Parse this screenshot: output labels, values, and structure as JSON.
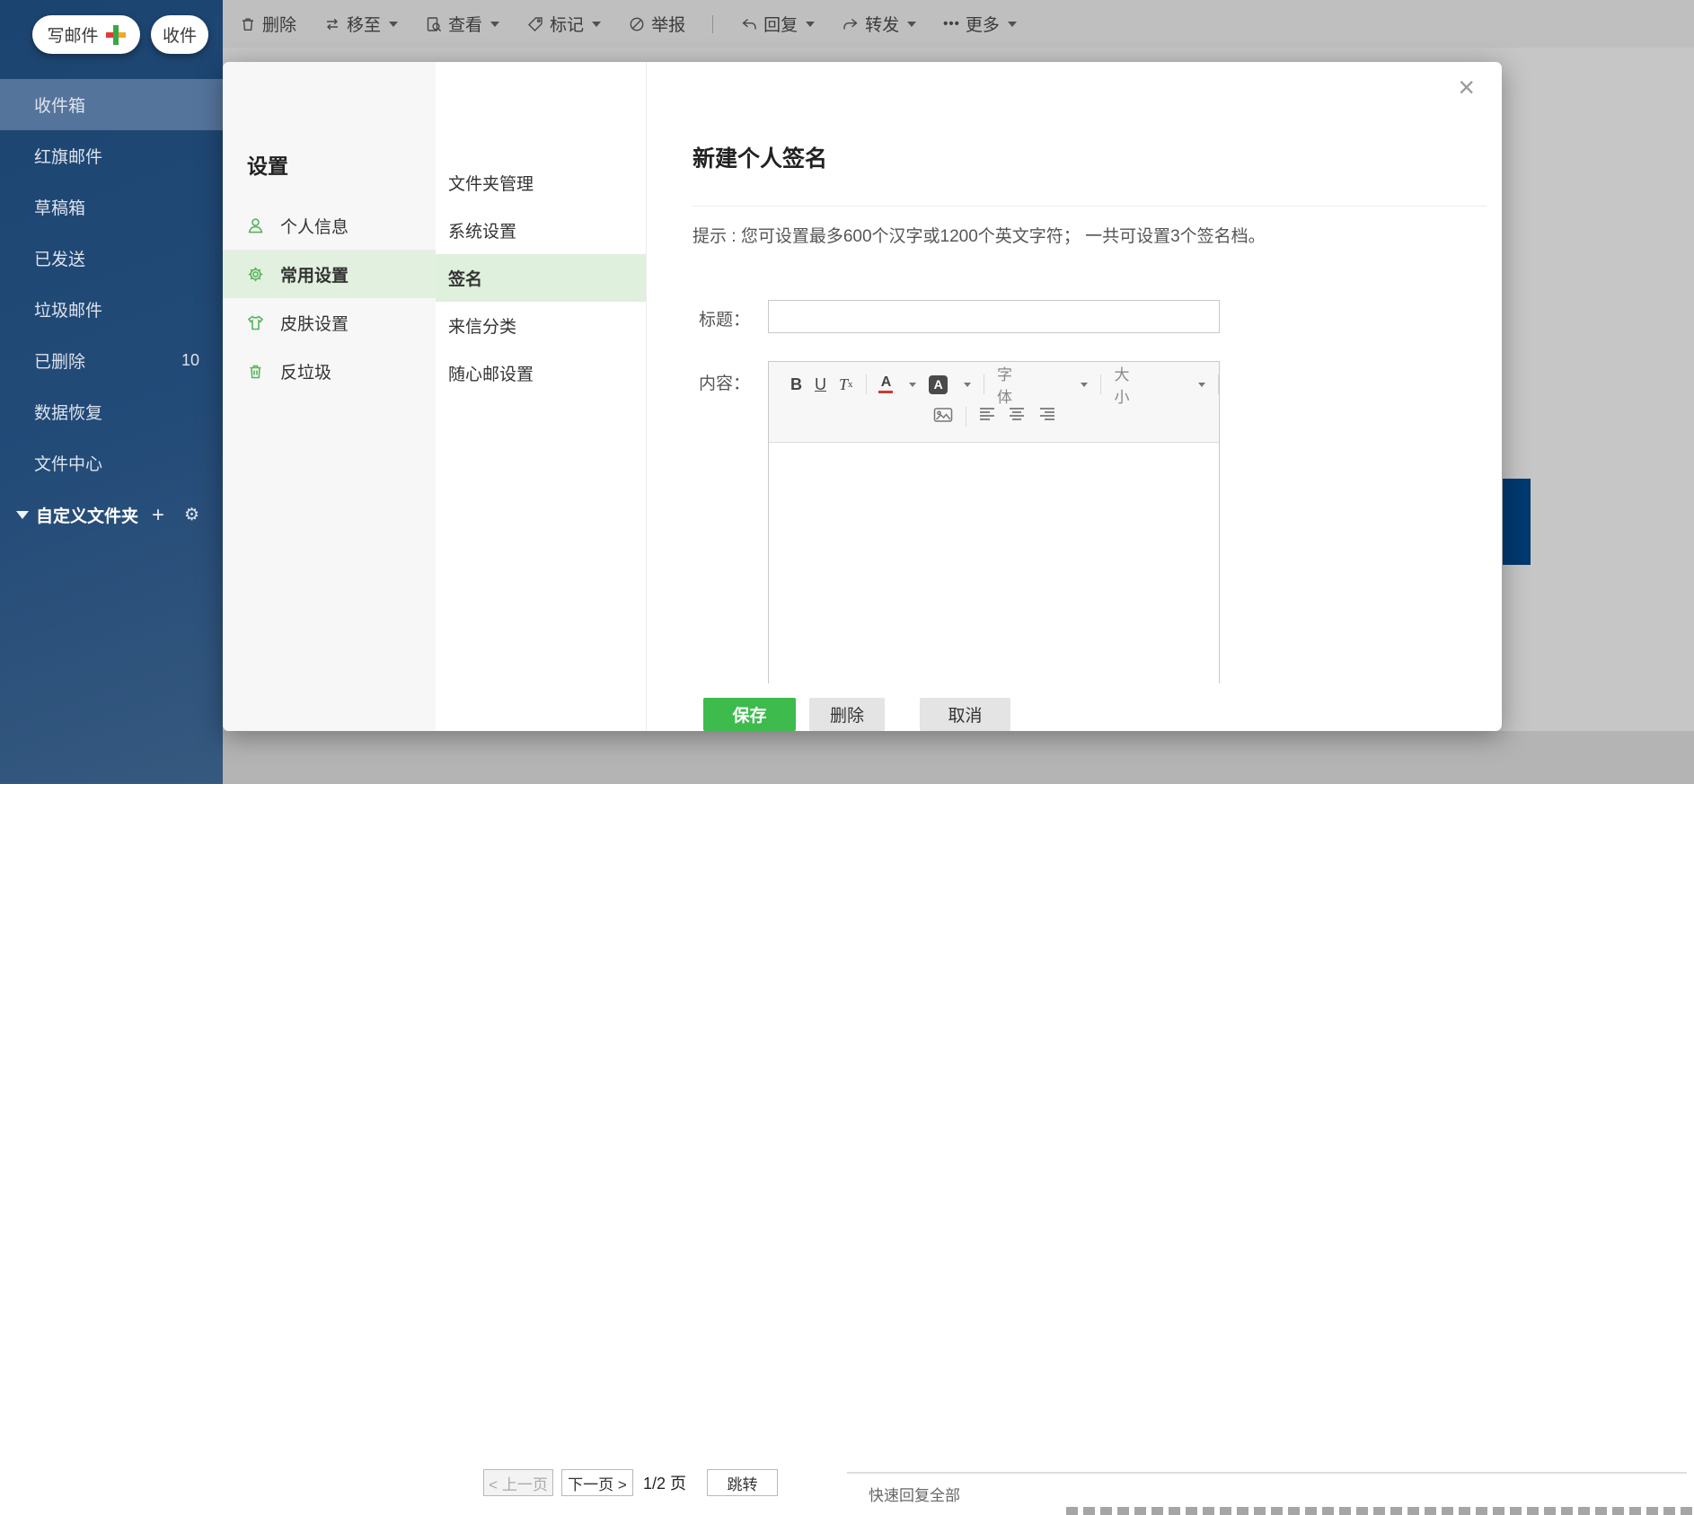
{
  "sidebar": {
    "compose": "写邮件",
    "receive": "收件",
    "folders": [
      {
        "label": "收件箱",
        "count": "",
        "selected": true
      },
      {
        "label": "红旗邮件",
        "count": ""
      },
      {
        "label": "草稿箱",
        "count": ""
      },
      {
        "label": "已发送",
        "count": ""
      },
      {
        "label": "垃圾邮件",
        "count": ""
      },
      {
        "label": "已删除",
        "count": "10"
      },
      {
        "label": "数据恢复",
        "count": ""
      },
      {
        "label": "文件中心",
        "count": ""
      }
    ],
    "custom_folders_label": "自定义文件夹",
    "custom_folders_add": "+",
    "custom_folders_gear": "⚙"
  },
  "toolbar": {
    "delete": "删除",
    "move": "移至",
    "view": "查看",
    "mark": "标记",
    "report": "举报",
    "reply": "回复",
    "forward": "转发",
    "more": "更多",
    "more_dots": "•••"
  },
  "settings": {
    "title": "设置",
    "nav": [
      {
        "label": "个人信息",
        "icon": "user-icon",
        "selected": false
      },
      {
        "label": "常用设置",
        "icon": "gear-icon",
        "selected": true
      },
      {
        "label": "皮肤设置",
        "icon": "shirt-icon",
        "selected": false
      },
      {
        "label": "反垃圾",
        "icon": "trash-icon",
        "selected": false
      }
    ],
    "subnav": [
      {
        "label": "文件夹管理",
        "selected": false
      },
      {
        "label": "系统设置",
        "selected": false
      },
      {
        "label": "签名",
        "selected": true
      },
      {
        "label": "来信分类",
        "selected": false
      },
      {
        "label": "随心邮设置",
        "selected": false
      }
    ]
  },
  "signature": {
    "title": "新建个人签名",
    "close": "×",
    "hint": "提示 : 您可设置最多600个汉字或1200个英文字符； 一共可设置3个签名档。",
    "field_title_label": "标题：",
    "field_title_value": "",
    "field_content_label": "内容：",
    "editor": {
      "bold": "B",
      "underline": "U",
      "clear_format": "T",
      "clear_format_sub": "x",
      "text_color": "A",
      "bg_color": "A",
      "font_select": "字体",
      "size_select": "大小"
    },
    "buttons": {
      "save": "保存",
      "delete": "删除",
      "cancel": "取消"
    }
  },
  "pagination": {
    "prev": "< 上一页",
    "next": "下一页 >",
    "page": "1/2 页",
    "jump": "跳转"
  },
  "footer": {
    "quick_reply": "快速回复全部"
  },
  "colors": {
    "accent_green": "#3dbb4d",
    "selected_green_bg": "#e2f1df",
    "sidebar_blue": "#1d4976",
    "sidebar_selected": "#55749c",
    "feedback_tab_blue": "#003a70",
    "color_picker_red": "#d0392e"
  }
}
